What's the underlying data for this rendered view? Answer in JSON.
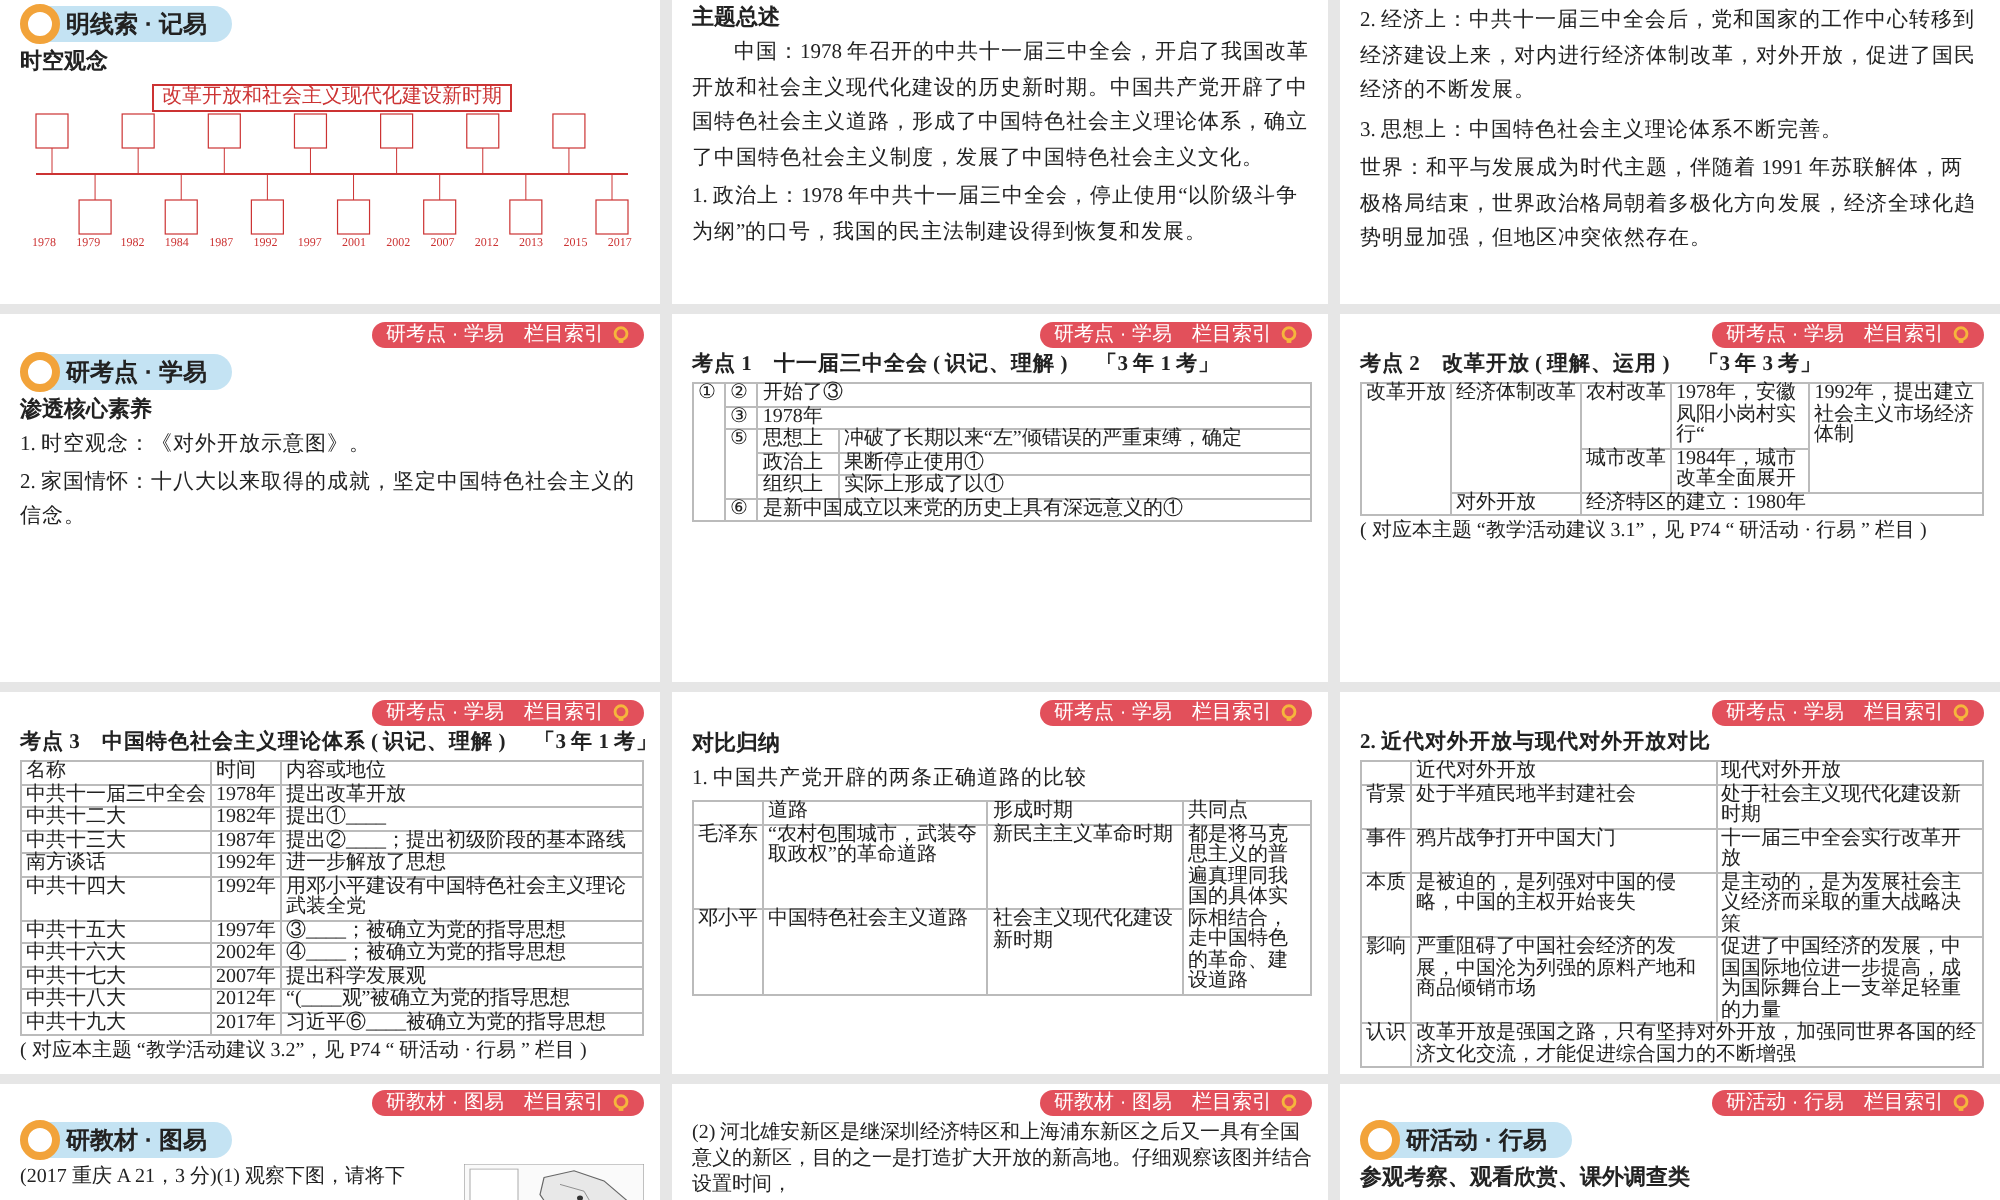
{
  "slides": [
    {
      "blocks": [
        {
          "kind": "badge",
          "text": "明线索 · 记易"
        },
        {
          "kind": "heading",
          "text": "时空观念"
        },
        {
          "kind": "timeline",
          "title": "改革开放和社会主义现代化建设新时期",
          "years": [
            "1978",
            "1979",
            "1982",
            "1984",
            "1987",
            "1992",
            "1997",
            "2001",
            "2002",
            "2007",
            "2012",
            "2013",
            "2015",
            "2017"
          ]
        }
      ]
    },
    {
      "blocks": [
        {
          "kind": "heading",
          "text": "主题总述"
        },
        {
          "kind": "para",
          "indent": true,
          "text": "中国：1978 年召开的中共十一届三中全会，开启了我国改革开放和社会主义现代化建设的历史新时期。中国共产党开辟了中国特色社会主义道路，形成了中国特色社会主义理论体系，确立了中国特色社会主义制度，发展了中国特色社会主义文化。"
        },
        {
          "kind": "para",
          "text": "1. 政治上：1978 年中共十一届三中全会，停止使用“以阶级斗争为纲”的口号，我国的民主法制建设得到恢复和发展。"
        }
      ]
    },
    {
      "blocks": [
        {
          "kind": "para",
          "text": "2. 经济上：中共十一届三中全会后，党和国家的工作中心转移到经济建设上来，对内进行经济体制改革，对外开放，促进了国民经济的不断发展。"
        },
        {
          "kind": "para",
          "text": "3. 思想上：中国特色社会主义理论体系不断完善。"
        },
        {
          "kind": "para",
          "text": "世界：和平与发展成为时代主题，伴随着 1991 年苏联解体，两极格局结束，世界政治格局朝着多极化方向发展，经济全球化趋势明显加强，但地区冲突依然存在。"
        }
      ]
    },
    {
      "index_button": "研考点 · 学易　栏目索引",
      "blocks": [
        {
          "kind": "badge",
          "text": "研考点 · 学易"
        },
        {
          "kind": "heading",
          "text": "渗透核心素养"
        },
        {
          "kind": "para",
          "text": "1. 时空观念：《对外开放示意图》。"
        },
        {
          "kind": "para",
          "text": "2. 家国情怀：十八大以来取得的成就，坚定中国特色社会主义的信念。"
        }
      ]
    },
    {
      "index_button": "研考点 · 学易　栏目索引",
      "blocks": [
        {
          "kind": "table",
          "title": "考点 1　十一届三中全会 ( 识记、理解 )",
          "frequency": "「3 年 1 考」",
          "rows": [
            [
              {
                "text": "①",
                "rowspan": 6
              },
              "②",
              {
                "text": "开始了③",
                "colspan": 2
              }
            ],
            [
              "③",
              {
                "text": "1978年",
                "colspan": 2
              }
            ],
            [
              {
                "text": "⑤",
                "rowspan": 3
              },
              "思想上",
              "冲破了长期以来“左”倾错误的严重束缚，确定"
            ],
            [
              "政治上",
              "果断停止使用①"
            ],
            [
              "组织上",
              "实际上形成了以①"
            ],
            [
              "⑥",
              {
                "text": "是新中国成立以来党的历史上具有深远意义的①",
                "colspan": 2
              }
            ]
          ]
        }
      ]
    },
    {
      "index_button": "研考点 · 学易　栏目索引",
      "blocks": [
        {
          "kind": "table",
          "title": "考点 2　改革开放 ( 理解、运用 )",
          "frequency": "「3 年 3 考」",
          "rows": [
            [
              {
                "text": "改革开放",
                "rowspan": 3
              },
              {
                "text": "经济体制改革",
                "rowspan": 2
              },
              "农村改革",
              "1978年，安徽凤阳小岗村实行“",
              {
                "text": "1992年，提出建立社会主义市场经济体制",
                "rowspan": 2
              }
            ],
            [
              "城市改革",
              "1984年，城市改革全面展开"
            ],
            [
              "对外开放",
              {
                "text": "经济特区的建立：1980年",
                "colspan": 3
              }
            ]
          ]
        },
        {
          "kind": "note",
          "text": "( 对应本主题 “教学活动建议 3.1”，见 P74 “ 研活动 · 行易 ” 栏目 )"
        }
      ]
    },
    {
      "index_button": "研考点 · 学易　栏目索引",
      "blocks": [
        {
          "kind": "table",
          "title": "考点 3　中国特色社会主义理论体系 ( 识记、理解 )",
          "frequency": "「3 年 1 考」",
          "columns": [
            "名称",
            "时间",
            "内容或地位"
          ],
          "rows": [
            [
              "中共十一届三中全会",
              "1978年",
              "提出改革开放"
            ],
            [
              "中共十二大",
              "1982年",
              "提出①____"
            ],
            [
              "中共十三大",
              "1987年",
              "提出②____；提出初级阶段的基本路线"
            ],
            [
              "南方谈话",
              "1992年",
              "进一步解放了思想"
            ],
            [
              "中共十四大",
              "1992年",
              "用邓小平建设有中国特色社会主义理论武装全党"
            ],
            [
              "中共十五大",
              "1997年",
              "③____；被确立为党的指导思想"
            ],
            [
              "中共十六大",
              "2002年",
              "④____；被确立为党的指导思想"
            ],
            [
              "中共十七大",
              "2007年",
              "提出科学发展观"
            ],
            [
              "中共十八大",
              "2012年",
              "“(____观”被确立为党的指导思想"
            ],
            [
              "中共十九大",
              "2017年",
              "习近平⑥____被确立为党的指导思想"
            ]
          ]
        },
        {
          "kind": "note",
          "text": "( 对应本主题 “教学活动建议 3.2”，见 P74 “ 研活动 · 行易 ” 栏目 )"
        }
      ]
    },
    {
      "index_button": "研考点 · 学易　栏目索引",
      "blocks": [
        {
          "kind": "heading",
          "text": "对比归纳"
        },
        {
          "kind": "para",
          "text": "1. 中国共产党开辟的两条正确道路的比较"
        },
        {
          "kind": "table",
          "columns": [
            "",
            "道路",
            "形成时期",
            "共同点"
          ],
          "rows": [
            [
              "毛泽东",
              "“农村包围城市，武装夺取政权”的革命道路",
              "新民主主义革命时期",
              {
                "text": "都是将马克思主义的普遍真理同我国的具体实际相结合，走中国特色的革命、建设道路",
                "rowspan": 2
              }
            ],
            [
              "邓小平",
              "中国特色社会主义道路",
              "社会主义现代化建设新时期"
            ]
          ]
        }
      ]
    },
    {
      "index_button": "研考点 · 学易　栏目索引",
      "blocks": [
        {
          "kind": "table",
          "title": "2. 近代对外开放与现代对外开放对比",
          "columns": [
            "",
            "近代对外开放",
            "现代对外开放"
          ],
          "rows": [
            [
              "背景",
              "处于半殖民地半封建社会",
              "处于社会主义现代化建设新时期"
            ],
            [
              "事件",
              "鸦片战争打开中国大门",
              "十一届三中全会实行改革开放"
            ],
            [
              "本质",
              "是被迫的，是列强对中国的侵略，中国的主权开始丧失",
              "是主动的，是为发展社会主义经济而采取的重大战略决策"
            ],
            [
              "影响",
              "严重阻碍了中国社会经济的发展，中国沦为列强的原料产地和商品倾销市场",
              "促进了中国经济的发展，中国国际地位进一步提高，成为国际舞台上一支举足轻重的力量"
            ],
            [
              "认识",
              {
                "text": "改革开放是强国之路，只有坚持对外开放，加强同世界各国的经济文化交流，才能促进综合国力的不断增强",
                "colspan": 2
              }
            ]
          ]
        }
      ]
    },
    {
      "index_button": "研教材 · 图易　栏目索引",
      "blocks": [
        {
          "kind": "badge",
          "text": "研教材 · 图易"
        },
        {
          "kind": "para",
          "text": "(2017 重庆 A 21，3 分)(1) 观察下图，请将下",
          "picture": true
        }
      ]
    },
    {
      "index_button": "研教材 · 图易　栏目索引",
      "blocks": [
        {
          "kind": "para",
          "text": "(2) 河北雄安新区是继深圳经济特区和上海浦东新区之后又一具有全国意义的新区，目的之一是打造扩大开放的新高地。仔细观察该图并结合设置时间，"
        }
      ]
    },
    {
      "index_button": "研活动 · 行易　栏目索引",
      "blocks": [
        {
          "kind": "badge",
          "text": "研活动 · 行易"
        },
        {
          "kind": "heading",
          "text": "参观考察、观看欣赏、课外调查类"
        }
      ]
    }
  ]
}
